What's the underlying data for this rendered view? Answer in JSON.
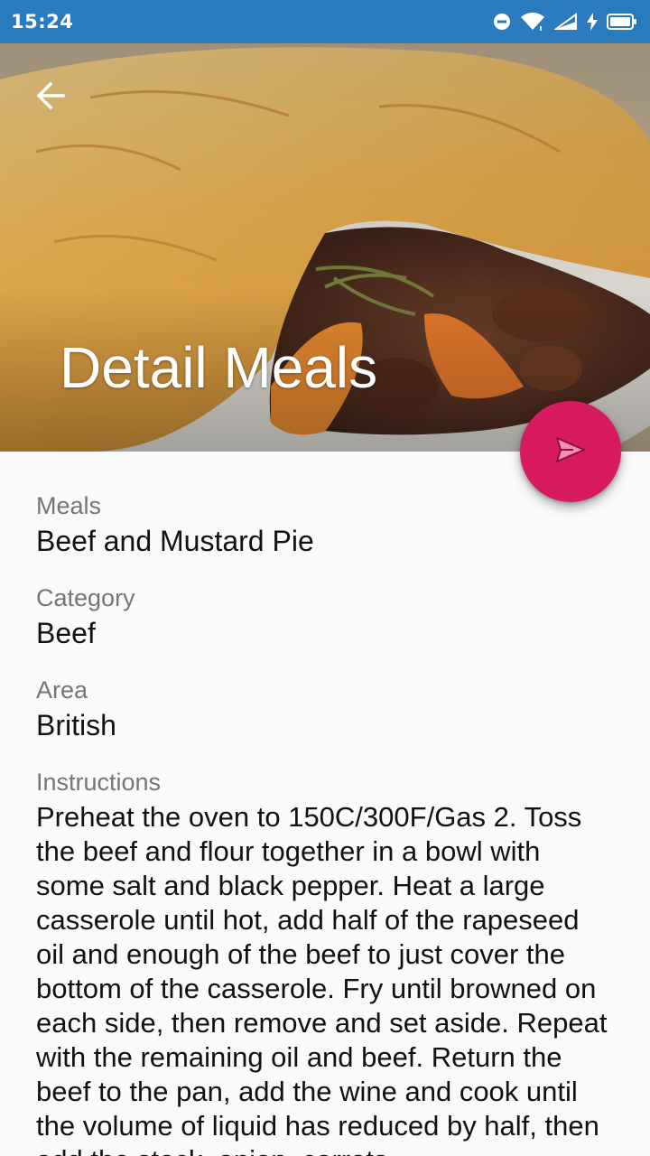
{
  "status_bar": {
    "time": "15:24",
    "icons": [
      "do-not-disturb-icon",
      "wifi-icon",
      "cell-signal-icon",
      "charging-icon",
      "battery-icon"
    ]
  },
  "toolbar": {
    "back_icon": "arrow-back-icon",
    "title": "Detail Meals"
  },
  "hero_image": {
    "subject": "beef-and-mustard-pie-photo"
  },
  "fab": {
    "icon": "send-icon",
    "color": "#d81b60"
  },
  "details": {
    "meal_label": "Meals",
    "meal_value": "Beef and Mustard Pie",
    "category_label": "Category",
    "category_value": "Beef",
    "area_label": "Area",
    "area_value": "British",
    "instructions_label": "Instructions",
    "instructions_value": "Preheat the oven to 150C/300F/Gas 2. Toss the beef and flour together in a bowl with some salt and black pepper. Heat a large casserole until hot, add half of the rapeseed oil and enough of the beef to just cover the bottom of the casserole. Fry until browned on each side, then remove and set aside. Repeat with the remaining oil and beef. Return the beef to the pan, add the wine and cook until the volume of liquid has reduced by half, then add the stock, onion, carrots"
  },
  "colors": {
    "status_bar": "#2a7bbd",
    "accent": "#d81b60",
    "label_text": "#757575",
    "value_text": "#111111",
    "background": "#fafafa"
  }
}
